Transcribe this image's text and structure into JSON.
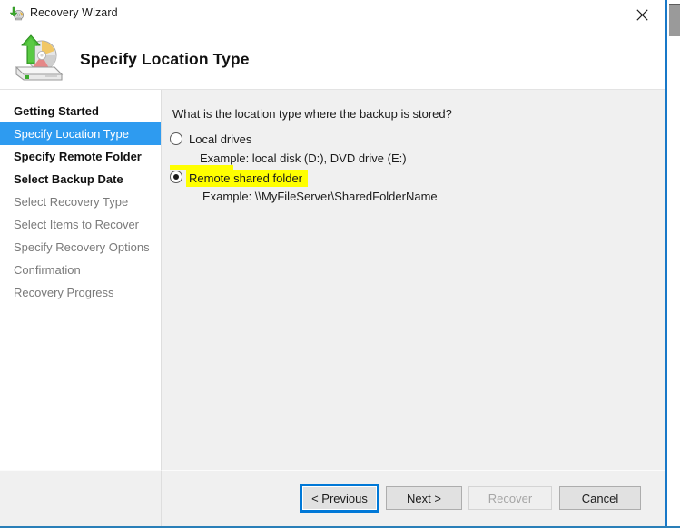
{
  "titlebar": {
    "title": "Recovery Wizard",
    "icon": "recovery-wizard-icon",
    "close_label": "close-icon"
  },
  "header": {
    "title": "Specify Location Type",
    "icon": "disk-restore-icon"
  },
  "sidebar": {
    "items": [
      {
        "label": "Getting Started",
        "state": "done"
      },
      {
        "label": "Specify Location Type",
        "state": "current"
      },
      {
        "label": "Specify Remote Folder",
        "state": "done"
      },
      {
        "label": "Select Backup Date",
        "state": "done"
      },
      {
        "label": "Select Recovery Type",
        "state": "pending"
      },
      {
        "label": "Select Items to Recover",
        "state": "pending"
      },
      {
        "label": "Specify Recovery Options",
        "state": "pending"
      },
      {
        "label": "Confirmation",
        "state": "pending"
      },
      {
        "label": "Recovery Progress",
        "state": "pending"
      }
    ]
  },
  "content": {
    "question": "What is the location type where the backup is stored?",
    "options": [
      {
        "label": "Local drives",
        "example": "Example: local disk (D:), DVD drive (E:)",
        "selected": false,
        "highlighted": false
      },
      {
        "label": "Remote shared folder",
        "example": "Example: \\\\MyFileServer\\SharedFolderName",
        "selected": true,
        "highlighted": true
      }
    ]
  },
  "buttons": {
    "previous": "< Previous",
    "next": "Next >",
    "recover": "Recover",
    "cancel": "Cancel"
  },
  "colors": {
    "accent": "#0078d7",
    "selection": "#2e9bf0",
    "highlight": "#ffff00",
    "panel": "#f0f0f0",
    "window_border": "#1878c8"
  }
}
